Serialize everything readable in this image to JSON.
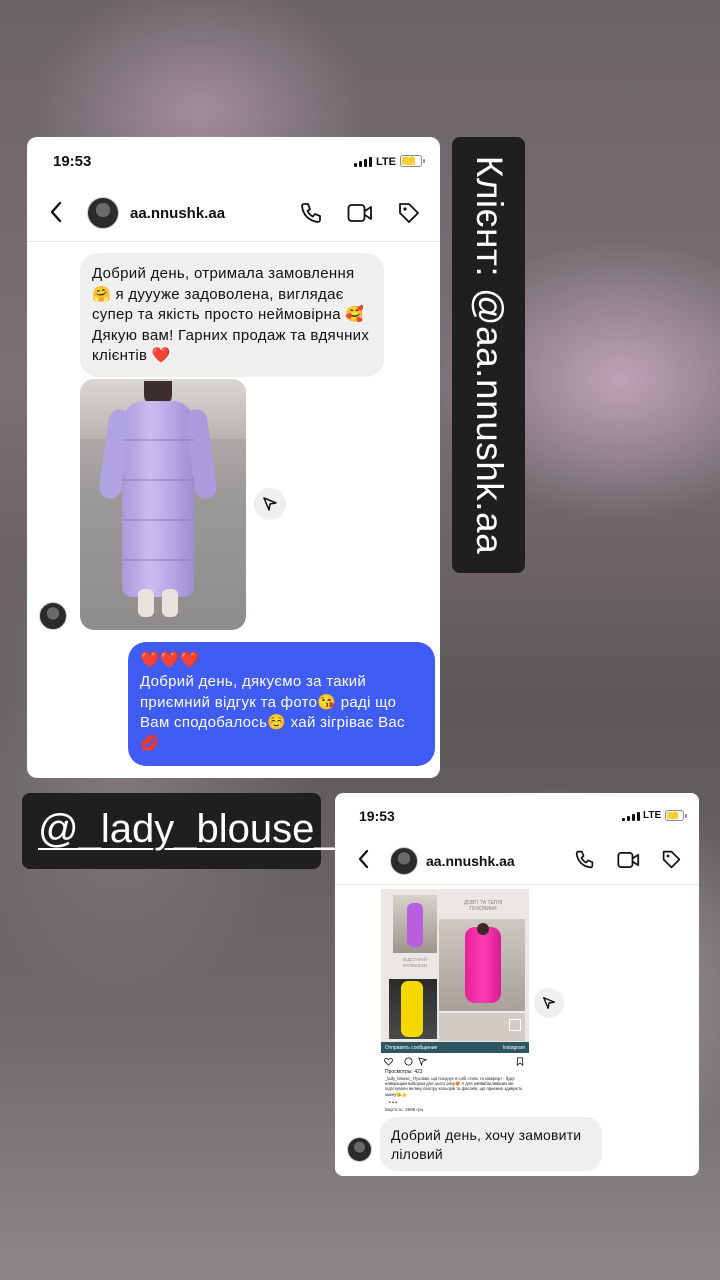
{
  "top_screenshot": {
    "status": {
      "time": "19:53",
      "network": "LTE"
    },
    "header": {
      "username": "aa.nnushk.aa"
    },
    "incoming_message": "Добрий день, отримала замовлення 🤗 я дуууже задоволена, виглядає супер та якість просто неймовірна 🥰 Дякую вам! Гарних продаж та вдячних клієнтів ❤️",
    "outgoing_message": {
      "hearts": "❤️❤️❤️",
      "text": "Добрий день, дякуємо за такий приємний відгук та фото😘 раді що Вам сподобалось☺️ хай зігріває Вас 💋"
    }
  },
  "client_label": "Клієнт: @aa.nnushk.aa",
  "brand_label": {
    "prefix": "@",
    "handle": "_lady_blouse_"
  },
  "bottom_screenshot": {
    "status": {
      "time": "19:53",
      "network": "LTE"
    },
    "header": {
      "username": "aa.nnushk.aa"
    },
    "shared_post": {
      "title_line1": "ДОВГІ ТА ТЕПЛІ",
      "title_line2": "ПУХОВИКИ",
      "side_text": "ВІДСТАНІЙ КАПЮШОН",
      "send_bar_left": "Отправить сообщение",
      "send_bar_right": "Instagram",
      "views": "Просмотры: 423",
      "caption": "_lady_blouse_ Пуховик, що поєднує в собі стиль та комфорт - буде найкращим вибором для цього року😍 А для найвибагливіших ми підготували велику палітру кольорів та фасонів, що приємно здивують кожну😘👍",
      "price": "Вартість: 2999 грн"
    },
    "incoming_message": "Добрий день, хочу замовити ліловий"
  },
  "colors": {
    "outgoing_bubble": "#3f5cf5",
    "incoming_bubble": "#efefef",
    "label_bg": "#1f1f1f"
  }
}
